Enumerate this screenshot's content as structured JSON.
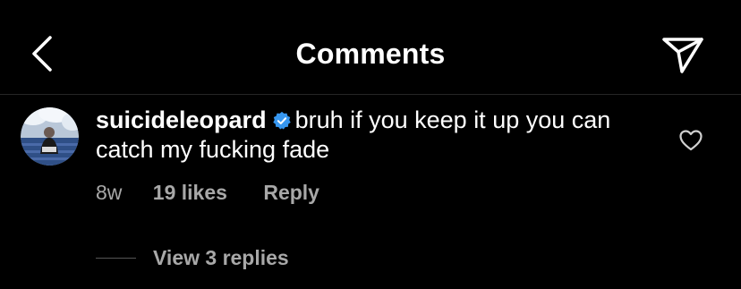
{
  "header": {
    "title": "Comments",
    "back_icon": "chevron-left-icon",
    "send_icon": "paper-plane-icon"
  },
  "comment": {
    "username": "suicideleopard",
    "verified_icon": "verified-badge-icon",
    "text": "bruh if you keep it up you can catch my fucking fade",
    "time": "8w",
    "likes": "19 likes",
    "reply_label": "Reply",
    "like_icon": "heart-outline-icon",
    "view_replies": "View 3 replies"
  },
  "colors": {
    "background": "#000000",
    "text": "#ffffff",
    "secondary_text": "#a8a8a8",
    "verified_blue": "#3797f0",
    "divider": "#262626"
  }
}
